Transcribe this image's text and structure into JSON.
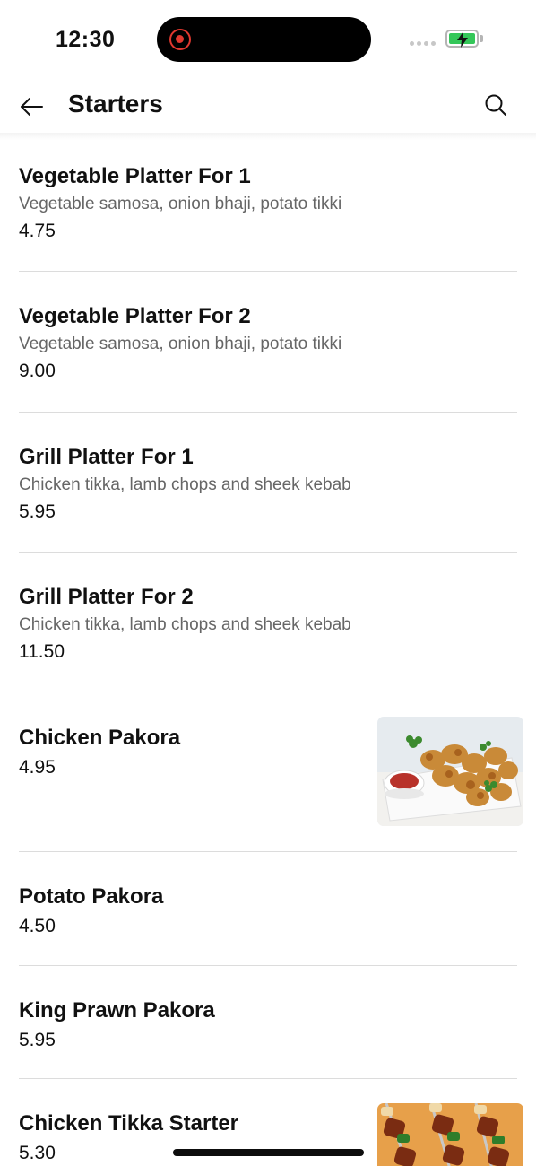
{
  "status_bar": {
    "time": "12:30",
    "battery_color": "#34c759",
    "recording_color": "#e0382f"
  },
  "header": {
    "title": "Starters",
    "back_icon": "arrow-left-icon",
    "search_icon": "search-icon"
  },
  "menu": {
    "items": [
      {
        "name": "Vegetable Platter For 1",
        "description": "Vegetable samosa, onion bhaji, potato tikki",
        "price": "4.75"
      },
      {
        "name": "Vegetable Platter For 2",
        "description": "Vegetable samosa, onion bhaji, potato tikki",
        "price": "9.00"
      },
      {
        "name": "Grill Platter For 1",
        "description": "Chicken tikka, lamb chops and sheek kebab",
        "price": "5.95"
      },
      {
        "name": "Grill Platter For 2",
        "description": "Chicken tikka, lamb chops and sheek kebab",
        "price": "11.50"
      },
      {
        "name": "Chicken Pakora",
        "price": "4.95",
        "image": "chicken-pakora-photo"
      },
      {
        "name": "Potato Pakora",
        "price": "4.50"
      },
      {
        "name": "King Prawn Pakora",
        "price": "5.95"
      },
      {
        "name": "Chicken Tikka Starter",
        "price": "5.30",
        "image": "chicken-tikka-photo"
      }
    ]
  }
}
